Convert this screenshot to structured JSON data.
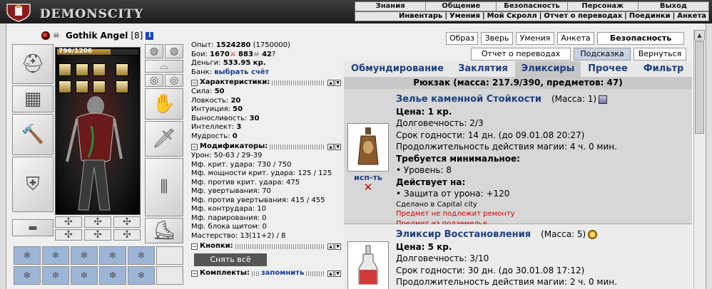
{
  "header": {
    "logo": "DEMONSCITY",
    "menu_top": [
      "Знания",
      "Общение",
      "Безопасность",
      "Персонаж",
      "Выход"
    ],
    "menu_sub": [
      "Инвентарь",
      "Умения",
      "Мой Скролл",
      "Отчет о переводах",
      "Поединки",
      "Анкета"
    ]
  },
  "character": {
    "name": "Gothik Angel",
    "level": "[8]",
    "info_icon": "i",
    "hp": "796/1206",
    "hp_fraction": 0.66
  },
  "summary": {
    "exp_label": "Опыт:",
    "exp_value": "1524280",
    "exp_next": "(1750000)",
    "fights_label": "Бои:",
    "wins": "1670",
    "losses": "883",
    "draws": "42",
    "money_label": "Деньги:",
    "money_value": "533.95 кр.",
    "bank_label": "Банк:",
    "bank_link": "выбрать счёт"
  },
  "characteristics": {
    "title": "Характеристики:",
    "rows": [
      {
        "label": "Сила:",
        "value": "50"
      },
      {
        "label": "Ловкость:",
        "value": "20"
      },
      {
        "label": "Интуиция:",
        "value": "50"
      },
      {
        "label": "Выносливость:",
        "value": "30"
      },
      {
        "label": "Интеллект:",
        "value": "3"
      },
      {
        "label": "Мудрость:",
        "value": "0"
      }
    ]
  },
  "modifiers": {
    "title": "Модификаторы:",
    "rows": [
      "Урон: 50-63 / 29-39",
      "Мф. крит. удара: 730 / 750",
      "Мф. мощности крит. удара: 125 / 125",
      "Мф. против крит. удара: 475",
      "Мф. увертывания: 70",
      "Мф. против увертывания: 415 / 455",
      "Мф. контрудара: 10",
      "Мф. парирования: 0",
      "Мф. блока щитом: 0",
      "Мастерство: 13(11+2) / 8"
    ]
  },
  "buttons_section": {
    "title": "Кнопки:",
    "unequip": "Снять всё"
  },
  "sets_section": {
    "title": "Комплекты:",
    "remember": "запомнить"
  },
  "right_buttons": {
    "row1": [
      "Образ",
      "Зверь",
      "Умения",
      "Анкета",
      "Безопасность"
    ],
    "row2": [
      "Отчет о переводах",
      "Подсказка",
      "Вернуться"
    ]
  },
  "tabs": [
    "Обмундирование",
    "Заклятия",
    "Эликсиры",
    "Прочее",
    "Фильтр"
  ],
  "active_tab": "Эликсиры",
  "backpack": "Рюкзак (масса: 217.9/390, предметов: 47)",
  "items": [
    {
      "name": "Зелье каменной Стойкости",
      "mass": "(Масса: 1)",
      "price": "Цена: 1 кр.",
      "durability": "Долговечность: 2/3",
      "expiry": "Срок годности: 14 дн. (до 09.01.08 20:27)",
      "duration": "Продолжительность действия магии: 4 ч. 0 мин.",
      "req_title": "Требуется минимальное:",
      "req": "• Уровень: 8",
      "effect_title": "Действует на:",
      "effect": "• Защита от урона: +120",
      "made": "Сделано в Capital city",
      "note1": "Предмет не подлежит ремонту",
      "note2": "Предмет из подземелья",
      "use": "исп-ть",
      "delete": "✕"
    },
    {
      "name": "Эликсир Восстановления",
      "mass": "(Масса: 5)",
      "price": "Цена: 5 кр.",
      "durability": "Долговечность: 3/10",
      "expiry": "Срок годности: 30 дн. (до 30.01.08 17:12)",
      "duration": "Продолжительность действия магии: 2 ч. 0 мин."
    }
  ],
  "colors": {
    "link": "#1d3f80",
    "warning": "#cc0000",
    "active_tab": "#c6c6c6",
    "hint_button": "#c9d3e1"
  }
}
